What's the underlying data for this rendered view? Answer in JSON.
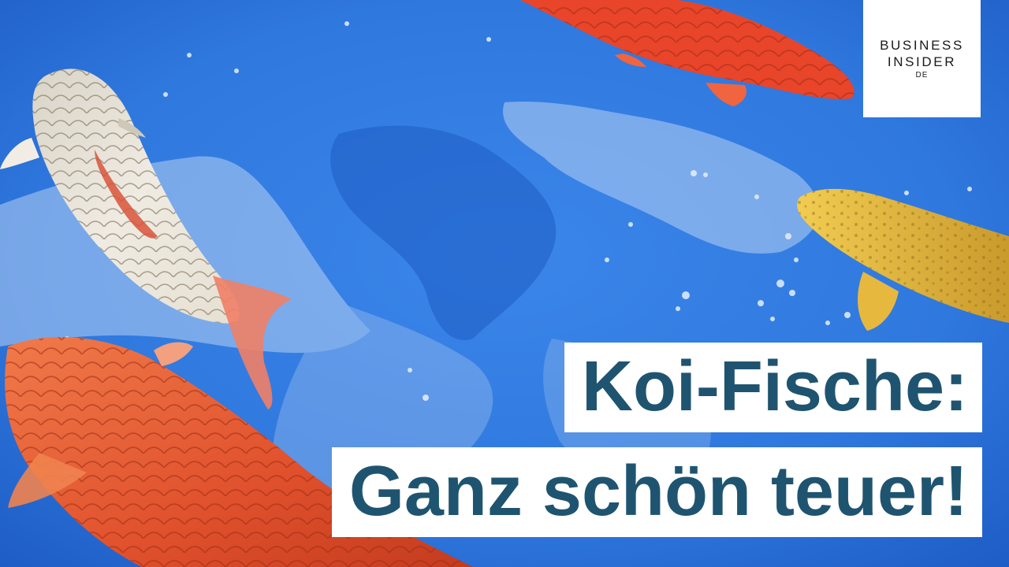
{
  "logo": {
    "line1": "BUSINESS",
    "line2": "INSIDER",
    "line3": "DE"
  },
  "headline": {
    "line1": "Koi-Fische:",
    "line2": "Ganz schön teuer!"
  },
  "colors": {
    "water": "#2f78de",
    "headline_text": "#1f5470",
    "box_bg": "#ffffff",
    "koi_orange": "#e4502a",
    "koi_white": "#e9e4d8",
    "koi_yellow": "#e8b93c"
  }
}
